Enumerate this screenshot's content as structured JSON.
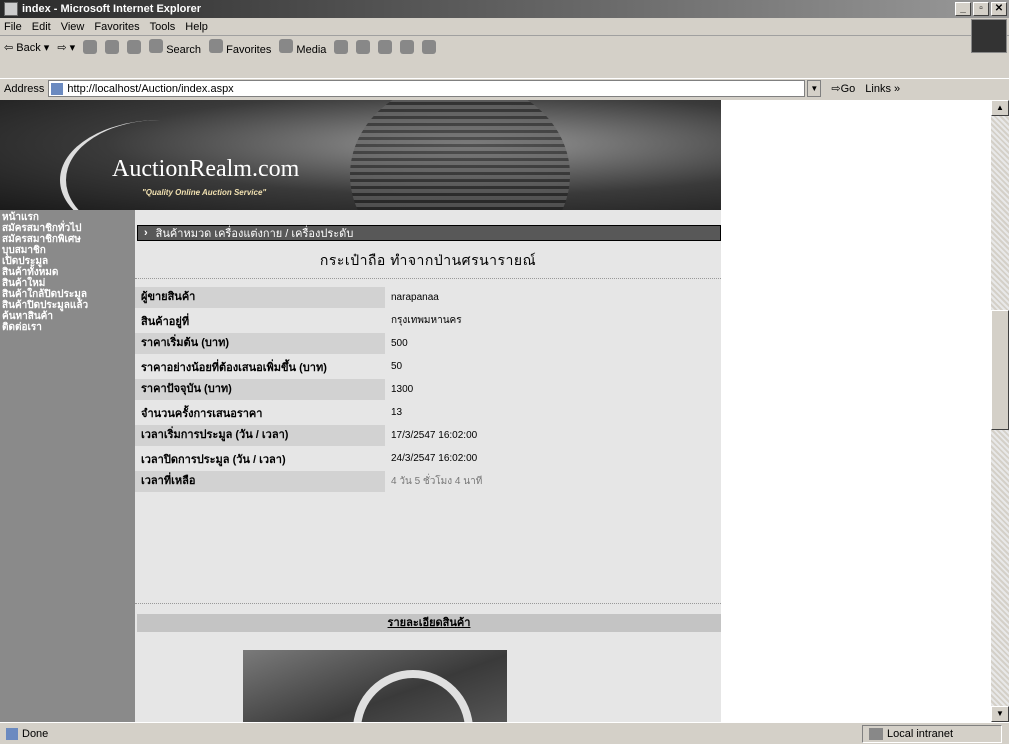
{
  "window": {
    "title": "index - Microsoft Internet Explorer"
  },
  "menu": [
    "File",
    "Edit",
    "View",
    "Favorites",
    "Tools",
    "Help"
  ],
  "toolbar": {
    "back": "Back",
    "search": "Search",
    "favorites": "Favorites",
    "media": "Media"
  },
  "address": {
    "label": "Address",
    "url": "http://localhost/Auction/index.aspx",
    "go": "Go",
    "links": "Links »"
  },
  "banner": {
    "logo": "AuctionRealm.com",
    "tagline": "\"Quality Online Auction Service\""
  },
  "nav": [
    "หน้าแรก",
    "สมัครสมาชิกทั่วไป",
    "สมัครสมาชิกพิเศษ",
    "บุบสมาชิก",
    "เปิดประมูล",
    "สินค้าทั้งหมด",
    "สินค้าใหม่",
    "สินค้าใกล้ปิดประมูล",
    "สินค้าปิดประมูลแล้ว",
    "ค้นหาสินค้า",
    "ติดต่อเรา"
  ],
  "category": "สินค้าหมวด เครื่องแต่งกาย / เครื่องประดับ",
  "product_title": "กระเป๋าถือ ทำจากป่านศรนารายณ์",
  "details": [
    {
      "label": "ผู้ขายสินค้า",
      "value": "narapanaa"
    },
    {
      "label": "สินค้าอยู่ที่",
      "value": "กรุงเทพมหานคร"
    },
    {
      "label": "ราคาเริ่มต้น (บาท)",
      "value": "500"
    },
    {
      "label": "ราคาอย่างน้อยที่ต้องเสนอเพิ่มขึ้น (บาท)",
      "value": "50"
    },
    {
      "label": "ราคาปัจจุบัน (บาท)",
      "value": "1300"
    },
    {
      "label": "จำนวนครั้งการเสนอราคา",
      "value": "13"
    },
    {
      "label": "เวลาเริ่มการประมูล (วัน / เวลา)",
      "value": "17/3/2547 16:02:00"
    },
    {
      "label": "เวลาปิดการประมูล (วัน / เวลา)",
      "value": "24/3/2547 16:02:00"
    },
    {
      "label": "เวลาที่เหลือ",
      "value": "4 วัน 5 ชั่วโมง 4 นาที"
    }
  ],
  "description_header": "รายละเอียดสินค้า",
  "status": {
    "text": "Done",
    "zone": "Local intranet"
  }
}
